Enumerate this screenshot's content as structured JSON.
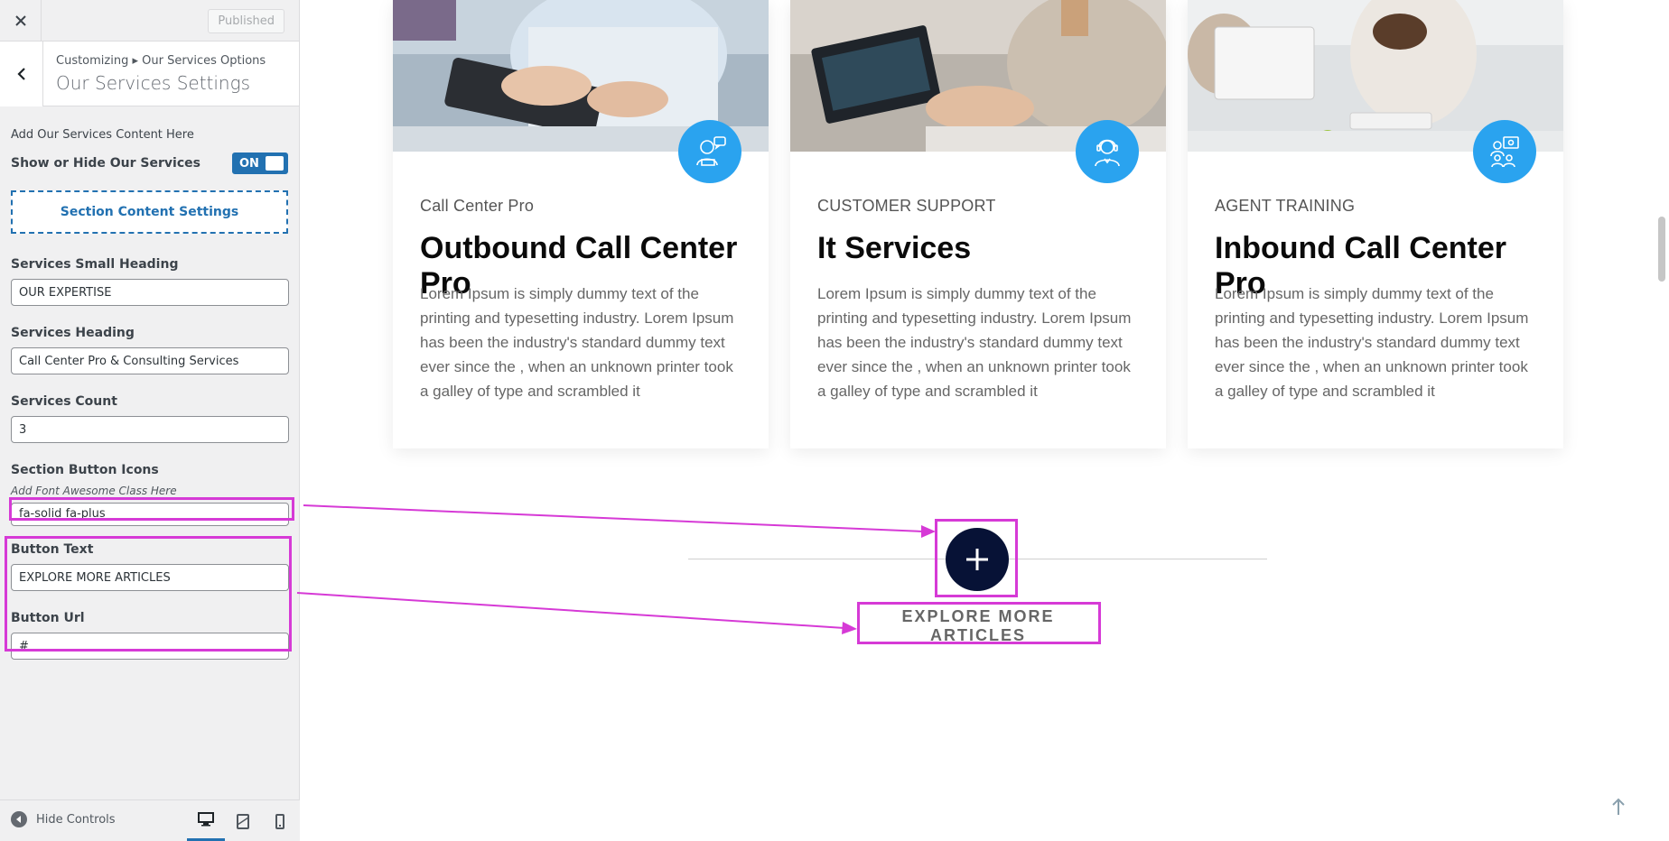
{
  "customizer": {
    "published_label": "Published",
    "breadcrumb": "Customizing ▸ Our Services Options",
    "section_title": "Our Services Settings",
    "description": "Add Our Services Content Here",
    "toggle": {
      "label": "Show or Hide Our Services",
      "state": "ON"
    },
    "section_content_button": "Section Content Settings",
    "fields": {
      "small_heading": {
        "label": "Services Small Heading",
        "value": "OUR EXPERTISE"
      },
      "heading": {
        "label": "Services Heading",
        "value": "Call Center Pro & Consulting Services"
      },
      "count": {
        "label": "Services Count",
        "value": "3"
      },
      "button_icons": {
        "label": "Section Button Icons",
        "hint": "Add Font Awesome Class Here",
        "value": "fa-solid fa-plus"
      },
      "button_text": {
        "label": "Button Text",
        "value": "EXPLORE MORE ARTICLES"
      },
      "button_url": {
        "label": "Button Url",
        "value": "#"
      }
    },
    "footer": {
      "hide_controls": "Hide Controls",
      "devices": [
        "desktop",
        "tablet",
        "mobile"
      ]
    }
  },
  "preview": {
    "cards": [
      {
        "small": "Call Center Pro",
        "title": "Outbound Call Center Pro",
        "text": "Lorem Ipsum is simply dummy text of the printing and typesetting industry. Lorem Ipsum has been the industry's standard dummy text ever since the , when an unknown printer took a galley of type and scrambled it",
        "icon": "woman-speech-icon"
      },
      {
        "small": "CUSTOMER SUPPORT",
        "title": "It Services",
        "text": "Lorem Ipsum is simply dummy text of the printing and typesetting industry. Lorem Ipsum has been the industry's standard dummy text ever since the , when an unknown printer took a galley of type and scrambled it",
        "icon": "headset-agent-icon"
      },
      {
        "small": "AGENT TRAINING",
        "title": "Inbound Call Center Pro",
        "text": "Lorem Ipsum is simply dummy text of the printing and typesetting industry. Lorem Ipsum has been the industry's standard dummy text ever since the , when an unknown printer took a galley of type and scrambled it",
        "icon": "training-group-icon"
      }
    ],
    "explore_button": "EXPLORE MORE ARTICLES",
    "plus_icon": "plus-icon"
  },
  "colors": {
    "accent_blue": "#2aa3ef",
    "navy": "#071236",
    "annotation_magenta": "#d63ad6",
    "wp_blue": "#2271b1"
  }
}
